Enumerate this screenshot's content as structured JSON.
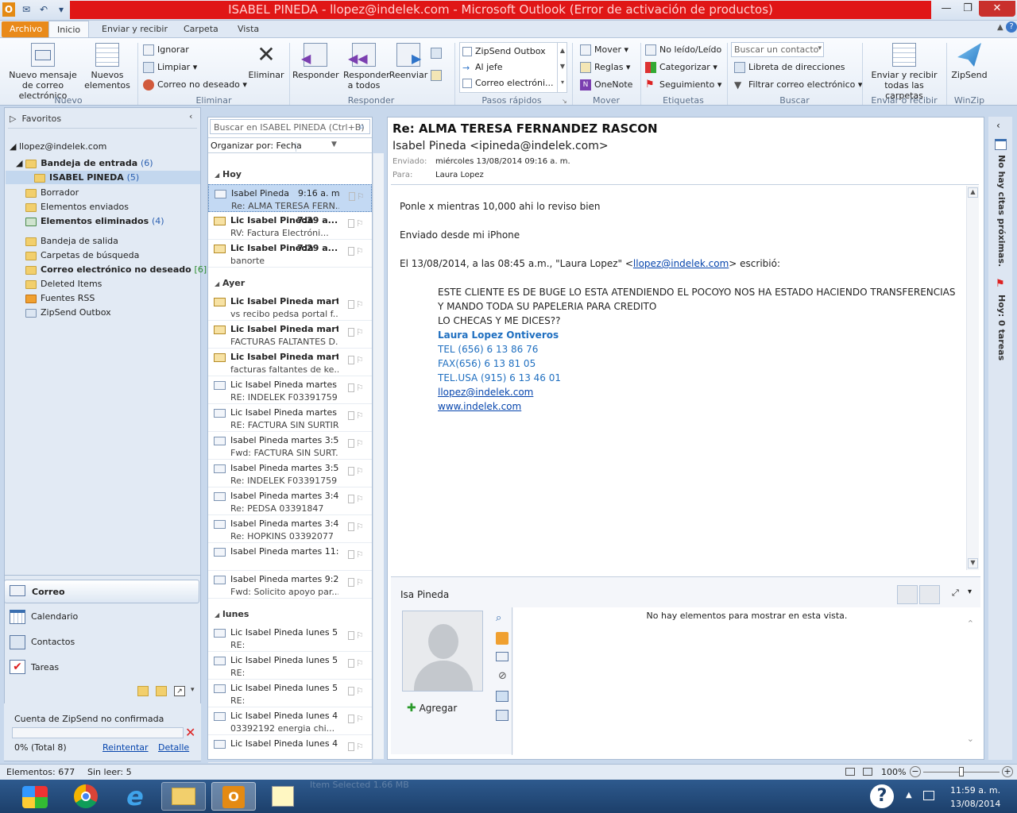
{
  "window": {
    "title": "ISABEL PINEDA - llopez@indelek.com  -  Microsoft Outlook (Error de activación de productos)"
  },
  "tabs": [
    "Archivo",
    "Inicio",
    "Enviar y recibir",
    "Carpeta",
    "Vista"
  ],
  "ribbon": {
    "nuevo": {
      "new_mail": "Nuevo mensaje de correo electrónico",
      "new_items": "Nuevos elementos",
      "group": "Nuevo"
    },
    "eliminar": {
      "ignore": "Ignorar",
      "clean": "Limpiar",
      "junk": "Correo no deseado",
      "delete": "Eliminar",
      "group": "Eliminar"
    },
    "responder": {
      "reply": "Responder",
      "reply_all": "Responder a todos",
      "forward": "Reenviar",
      "group": "Responder"
    },
    "pasos": {
      "items": [
        "ZipSend Outbox",
        "Al jefe",
        "Correo electróni..."
      ],
      "group": "Pasos rápidos"
    },
    "mover": {
      "move": "Mover",
      "rules": "Reglas",
      "onenote": "OneNote",
      "group": "Mover"
    },
    "etiquetas": {
      "unread": "No leído/Leído",
      "categorize": "Categorizar",
      "followup": "Seguimiento",
      "group": "Etiquetas"
    },
    "buscar": {
      "contact_placeholder": "Buscar un contacto",
      "address_book": "Libreta de direcciones",
      "filter": "Filtrar correo electrónico",
      "group": "Buscar"
    },
    "enviar": {
      "send_all": "Enviar y recibir todas las carpetas",
      "group": "Enviar o recibir"
    },
    "winzip": {
      "zipsend": "ZipSend",
      "group": "WinZip"
    }
  },
  "nav": {
    "favorites": "Favoritos",
    "account": "llopez@indelek.com",
    "folders": [
      {
        "label": "Bandeja de entrada",
        "count": "(6)",
        "bold": true
      },
      {
        "label": "ISABEL PINEDA",
        "count": "(5)",
        "bold": true
      },
      {
        "label": "Borrador",
        "count": ""
      },
      {
        "label": "Elementos enviados",
        "count": ""
      },
      {
        "label": "Elementos eliminados",
        "count": "(4)",
        "bold": true
      },
      {
        "label": "Bandeja de salida",
        "count": ""
      },
      {
        "label": "Carpetas de búsqueda",
        "count": ""
      },
      {
        "label": "Correo electrónico no deseado",
        "count": "[6]",
        "bold": true
      },
      {
        "label": "Deleted Items",
        "count": ""
      },
      {
        "label": "Fuentes RSS",
        "count": ""
      },
      {
        "label": "ZipSend Outbox",
        "count": ""
      }
    ],
    "buttons": [
      "Correo",
      "Calendario",
      "Contactos",
      "Tareas"
    ],
    "zipsend": {
      "title": "Cuenta de ZipSend no confirmada",
      "progress": "0% (Total 8)",
      "retry": "Reintentar",
      "detail": "Detalle"
    }
  },
  "list": {
    "search_placeholder": "Buscar en ISABEL PINEDA (Ctrl+B)",
    "arrange": "Organizar por: Fecha",
    "groups": [
      "Hoy",
      "Ayer",
      "lunes"
    ],
    "today": [
      {
        "from": "Isabel Pineda",
        "time": "9:16 a. m.",
        "subject": "Re: ALMA TERESA FERN...",
        "read": true,
        "selected": true
      },
      {
        "from": "Lic Isabel Pineda",
        "time": "7:39 a....",
        "subject": "RV: Factura Electróni...",
        "read": false
      },
      {
        "from": "Lic Isabel Pineda",
        "time": "7:29 a....",
        "subject": "banorte",
        "read": false
      }
    ],
    "yesterday": [
      {
        "from": "Lic Isabel Pineda martes...",
        "subject": "vs recibo pedsa portal f...",
        "read": false
      },
      {
        "from": "Lic Isabel Pineda martes...",
        "subject": "FACTURAS FALTANTES D...",
        "read": false
      },
      {
        "from": "Lic Isabel Pineda martes...",
        "subject": "facturas faltantes de ke...",
        "read": false
      },
      {
        "from": "Lic Isabel Pineda martes ...",
        "subject": "RE: INDELEK  F03391759",
        "read": true
      },
      {
        "from": "Lic Isabel Pineda martes ...",
        "subject": "RE: FACTURA SIN SURTIR",
        "read": true
      },
      {
        "from": "Isabel Pineda martes 3:5...",
        "subject": "Fwd: FACTURA SIN SURT...",
        "read": true
      },
      {
        "from": "Isabel Pineda martes 3:5...",
        "subject": "Re: INDELEK  F03391759",
        "read": true
      },
      {
        "from": "Isabel Pineda martes 3:4...",
        "subject": "Re: PEDSA 03391847",
        "read": true
      },
      {
        "from": "Isabel Pineda martes 3:4...",
        "subject": "Re: HOPKINS 03392077",
        "read": true
      },
      {
        "from": "Isabel Pineda martes 11:...",
        "subject": "",
        "read": true
      },
      {
        "from": "Isabel Pineda martes 9:2...",
        "subject": "Fwd: Solicito apoyo par...",
        "read": true
      }
    ],
    "monday": [
      {
        "from": "Lic Isabel Pineda lunes 5...",
        "subject": "RE:",
        "read": true
      },
      {
        "from": "Lic Isabel Pineda lunes 5...",
        "subject": "RE:",
        "read": true
      },
      {
        "from": "Lic Isabel Pineda lunes 5...",
        "subject": "RE:",
        "read": true
      },
      {
        "from": "Lic Isabel Pineda lunes 4...",
        "subject": "03392192 energia chi...",
        "read": true
      },
      {
        "from": "Lic Isabel Pineda lunes 4...",
        "subject": "",
        "read": true
      }
    ]
  },
  "message": {
    "subject": "Re: ALMA TERESA FERNANDEZ RASCON",
    "sender": "Isabel Pineda <ipineda@indelek.com>",
    "sent_label": "Enviado:",
    "sent_value": "miércoles 13/08/2014 09:16 a. m.",
    "to_label": "Para:",
    "to_value": "Laura Lopez",
    "line1": "Ponle x mientras 10,000 ahi lo reviso bien",
    "line2": "Enviado desde mi iPhone",
    "quote_pre": "El 13/08/2014, a las 08:45 a.m., \"Laura Lopez\" <",
    "quote_email": "llopez@indelek.com",
    "quote_post": "> escribió:",
    "q1": "ESTE CLIENTE ES DE BUGE LO ESTA ATENDIENDO EL POCOYO NOS HA ESTADO HACIENDO TRANSFERENCIAS",
    "q2": "Y MANDO TODA SU PAPELERIA PARA CREDITO",
    "q3": "LO CHECAS Y ME DICES??",
    "sig_name": "Laura Lopez Ontiveros",
    "sig_tel": "TEL (656) 6 13 86 76",
    "sig_fax": "FAX(656) 6 13 81 05",
    "sig_telusa": "TEL.USA (915) 6 13 46 01",
    "sig_email": "llopez@indelek.com",
    "sig_web": "www.indelek.com"
  },
  "people": {
    "name": "Isa Pineda",
    "empty": "No hay elementos para mostrar en esta vista.",
    "add": "Agregar"
  },
  "todo": {
    "appointments": "No hay citas próximas.",
    "tasks": "Hoy: 0 tareas"
  },
  "status": {
    "items": "Elementos: 677",
    "unread": "Sin leer: 5",
    "zoom": "100%"
  },
  "taskbar": {
    "ghost": "Item Selected  1.66 MB",
    "time": "11:59 a. m.",
    "date": "13/08/2014"
  }
}
